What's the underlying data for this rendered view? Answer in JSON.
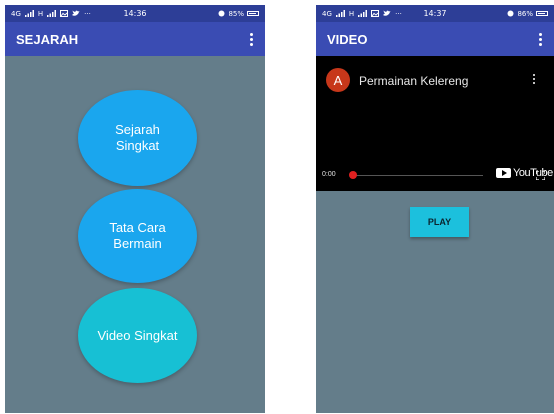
{
  "left_phone": {
    "status": {
      "network": "4G",
      "carrier": "H",
      "time": "14:36",
      "battery": "85%"
    },
    "appbar": {
      "title": "SEJARAH"
    },
    "buttons": [
      {
        "label": "Sejarah\nSingkat",
        "color": "#1aa6ee"
      },
      {
        "label": "Tata Cara\nBermain",
        "color": "#1aa6ee"
      },
      {
        "label": "Video Singkat",
        "color": "#17c0d4"
      }
    ]
  },
  "right_phone": {
    "status": {
      "network": "4G",
      "carrier": "H",
      "time": "14:37",
      "battery": "86%"
    },
    "appbar": {
      "title": "VIDEO"
    },
    "video": {
      "avatar_letter": "A",
      "title": "Permainan Kelereng",
      "current_time": "0:00",
      "brand": "YouTube"
    },
    "play_button": {
      "label": "PLAY"
    }
  },
  "colors": {
    "statusbar": "#2d3e97",
    "appbar": "#3a4cb3",
    "background": "#647d8a",
    "play_button": "#1cc0dd",
    "progress": "#e02020"
  },
  "icons": [
    "signal-icon",
    "image-icon",
    "twitter-icon",
    "alarm-icon",
    "battery-icon",
    "more-vert-icon",
    "youtube-logo-icon",
    "fullscreen-icon"
  ]
}
